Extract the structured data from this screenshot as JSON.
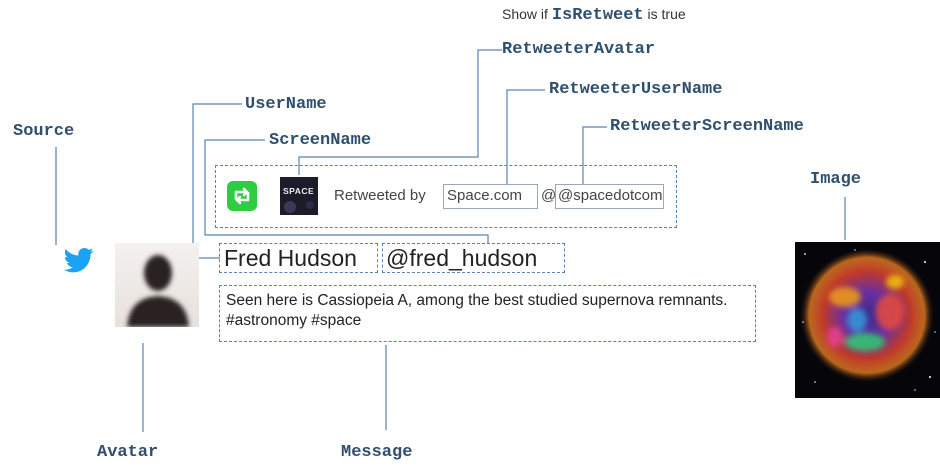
{
  "labels": {
    "show_if_prefix": "Show if",
    "show_if_code": "IsRetweet",
    "show_if_suffix": "is true",
    "retweeter_avatar": "RetweeterAvatar",
    "retweeter_user_name": "RetweeterUserName",
    "retweeter_screen_name": "RetweeterScreenName",
    "user_name": "UserName",
    "screen_name": "ScreenName",
    "source": "Source",
    "image": "Image",
    "avatar": "Avatar",
    "message": "Message"
  },
  "retweet": {
    "prefix": "Retweeted by",
    "user_name": "Space.com",
    "screen_name": "@spacedotcom",
    "avatar_text": "SPACE"
  },
  "tweet": {
    "user_name": "Fred Hudson",
    "screen_name": "@fred_hudson",
    "message": "Seen here is Cassiopeia A, among the best studied supernova remnants. #astronomy #space"
  },
  "colors": {
    "label": "#2f4f6f",
    "connector": "#5b82b0",
    "twitter": "#1da1f2",
    "retweet_green": "#2ecc40"
  }
}
